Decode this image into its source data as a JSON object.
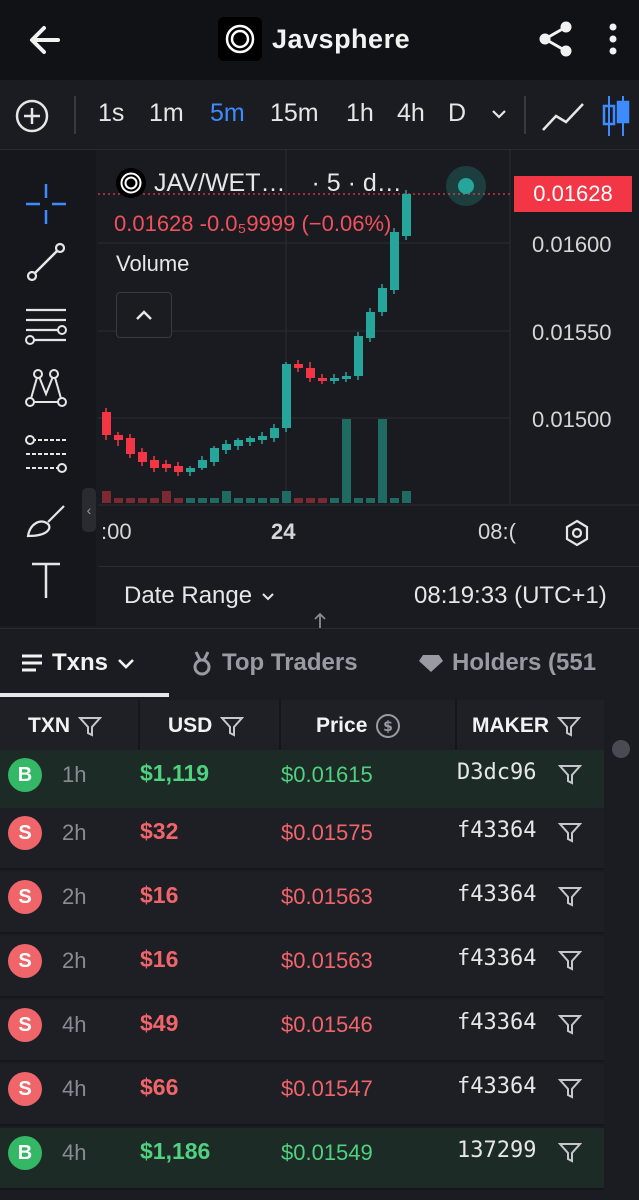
{
  "app": {
    "title": "Javsphere"
  },
  "timeframes": [
    {
      "label": "1s"
    },
    {
      "label": "1m"
    },
    {
      "label": "5m",
      "active": true
    },
    {
      "label": "15m"
    },
    {
      "label": "1h"
    },
    {
      "label": "4h"
    },
    {
      "label": "D"
    }
  ],
  "chart": {
    "pair": "JAV/WET…",
    "interval": "· 5 · d…",
    "ohlc": "0.01628  -0.0₅9999 (−0.06%)",
    "volume_label": "Volume",
    "last_price": "0.01628",
    "y_ticks": [
      "0.01600",
      "0.01550",
      "0.01500"
    ],
    "x_ticks": [
      ":00",
      "24",
      "08:("
    ],
    "date_range_label": "Date Range",
    "timestamp": "08:19:33 (UTC+1)",
    "up_color": "#26a69a",
    "down_color": "#f23645"
  },
  "tabs": {
    "txns": "Txns",
    "top_traders": "Top Traders",
    "holders": "Holders (551"
  },
  "table": {
    "headers": {
      "txn": "TXN",
      "usd": "USD",
      "price": "Price",
      "maker": "MAKER"
    },
    "rows": [
      {
        "type": "B",
        "age": "1h",
        "usd": "$1,119",
        "price": "$0.01615",
        "maker": "D3dc96"
      },
      {
        "type": "S",
        "age": "2h",
        "usd": "$32",
        "price": "$0.01575",
        "maker": "f43364"
      },
      {
        "type": "S",
        "age": "2h",
        "usd": "$16",
        "price": "$0.01563",
        "maker": "f43364"
      },
      {
        "type": "S",
        "age": "2h",
        "usd": "$16",
        "price": "$0.01563",
        "maker": "f43364"
      },
      {
        "type": "S",
        "age": "4h",
        "usd": "$49",
        "price": "$0.01546",
        "maker": "f43364"
      },
      {
        "type": "S",
        "age": "4h",
        "usd": "$66",
        "price": "$0.01547",
        "maker": "f43364"
      },
      {
        "type": "B",
        "age": "4h",
        "usd": "$1,186",
        "price": "$0.01549",
        "maker": "137299"
      }
    ]
  }
}
